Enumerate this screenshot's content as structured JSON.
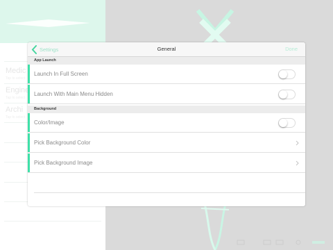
{
  "background": {
    "sidebar_items": [
      {
        "label": "Medic",
        "sub": "Tap to select"
      },
      {
        "label": "Engine",
        "sub": "Tap to select"
      },
      {
        "label": "Archi",
        "sub": "Tap to select"
      }
    ],
    "accent_color": "#3fe0a8"
  },
  "navbar": {
    "back_label": "Settings",
    "title": "General",
    "done_label": "Done"
  },
  "sections": [
    {
      "header": "App Launch",
      "rows": [
        {
          "label": "Launch In Full Screen",
          "control": "toggle",
          "on": false
        },
        {
          "label": "Launch With Main Menu Hidden",
          "control": "toggle",
          "on": false
        }
      ]
    },
    {
      "header": "Background",
      "rows": [
        {
          "label": "Color/Image",
          "control": "toggle",
          "on": false
        },
        {
          "label": "Pick Background Color",
          "control": "disclosure"
        },
        {
          "label": "Pick Background Image",
          "control": "disclosure"
        }
      ]
    }
  ]
}
